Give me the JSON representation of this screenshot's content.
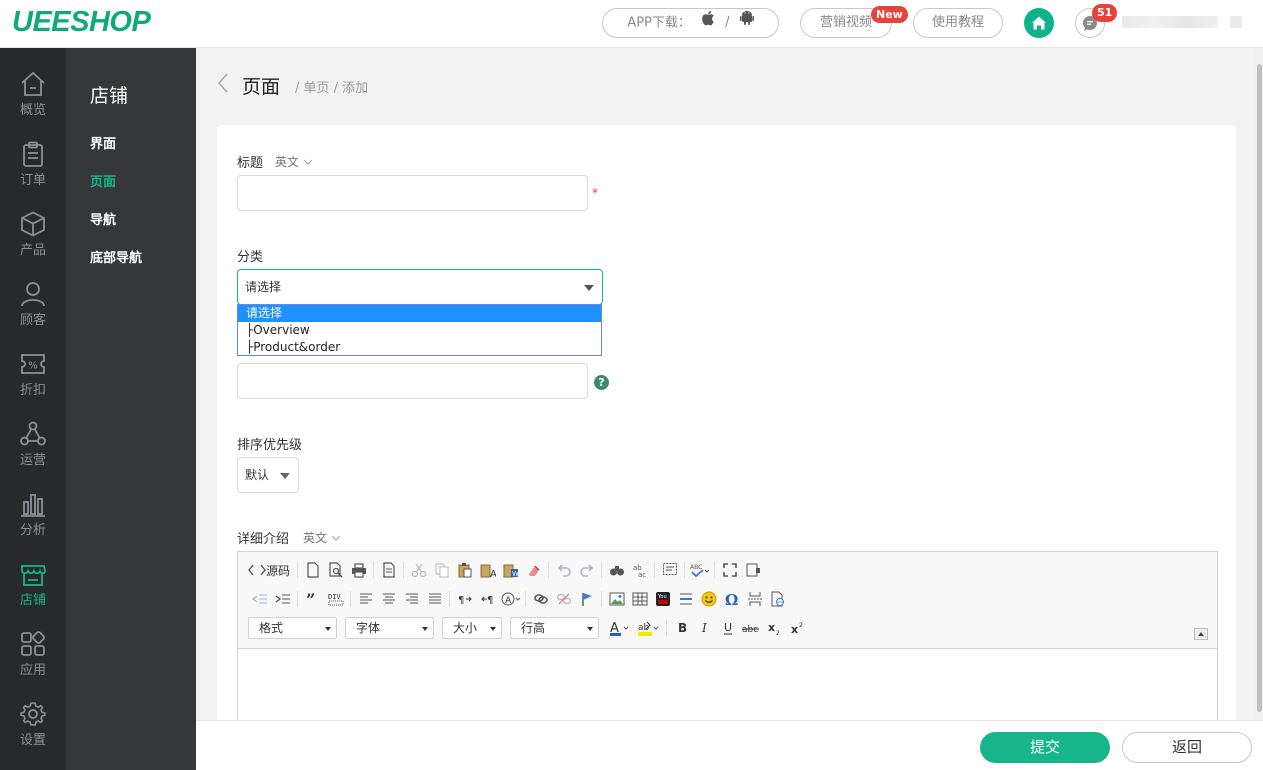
{
  "brand": {
    "logo": "UEESHOP",
    "accent": "#17b58a"
  },
  "topbar": {
    "app_download": "APP下载：",
    "app_separator": "/",
    "marketing_video": "营销视频",
    "new_badge": "New",
    "tutorial": "使用教程",
    "message_count": "51"
  },
  "leftnav": {
    "items": [
      {
        "label": "概览",
        "icon": "home-icon"
      },
      {
        "label": "订单",
        "icon": "clipboard-icon"
      },
      {
        "label": "产品",
        "icon": "cube-icon"
      },
      {
        "label": "顾客",
        "icon": "user-icon"
      },
      {
        "label": "折扣",
        "icon": "discount-icon"
      },
      {
        "label": "运营",
        "icon": "network-icon"
      },
      {
        "label": "分析",
        "icon": "bar-chart-icon"
      },
      {
        "label": "店铺",
        "icon": "store-icon",
        "active": true
      },
      {
        "label": "应用",
        "icon": "apps-icon"
      },
      {
        "label": "设置",
        "icon": "gear-icon"
      }
    ]
  },
  "subnav": {
    "title": "店铺",
    "items": [
      {
        "label": "界面"
      },
      {
        "label": "页面",
        "active": true
      },
      {
        "label": "导航"
      },
      {
        "label": "底部导航"
      }
    ]
  },
  "breadcrumb": {
    "title": "页面",
    "path": "/ 单页 / 添加"
  },
  "form": {
    "title_label": "标题",
    "title_lang": "英文",
    "title_required": "*",
    "category_label": "分类",
    "category_selected": "请选择",
    "category_options": [
      "请选择",
      "├Overview",
      "├Product&order"
    ],
    "help_symbol": "?",
    "sort_label": "排序优先级",
    "sort_value": "默认",
    "desc_label": "详细介绍",
    "desc_lang": "英文"
  },
  "editor": {
    "source_label": "源码",
    "format_label": "格式",
    "font_label": "字体",
    "size_label": "大小",
    "lineheight_label": "行高"
  },
  "footer": {
    "submit_label": "提交",
    "back_label": "返回"
  }
}
